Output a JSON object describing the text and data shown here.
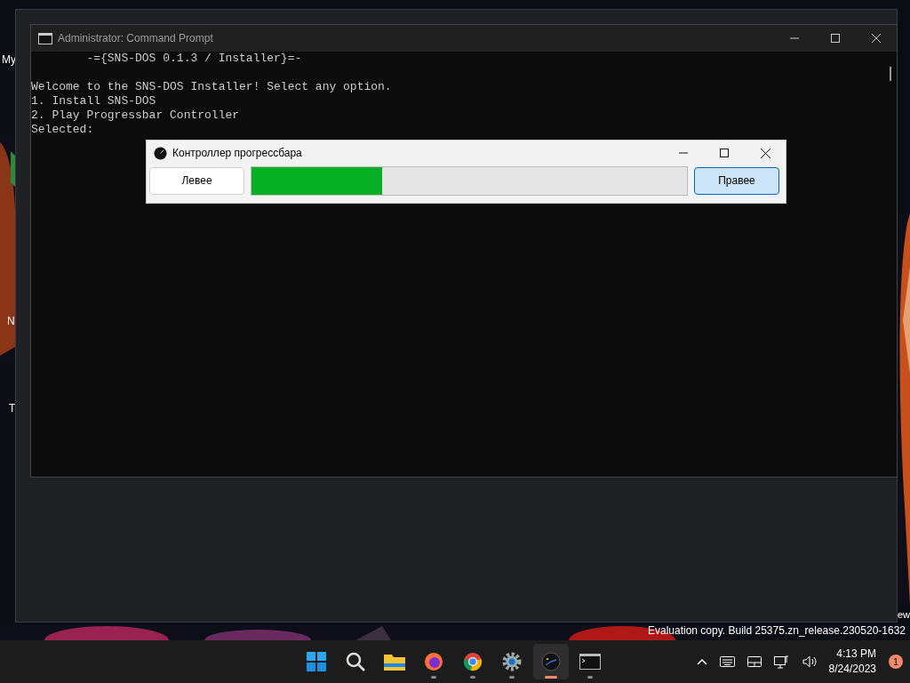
{
  "desktop": {
    "labels": [
      "My",
      "N",
      "T",
      "ew"
    ],
    "watermark": "Evaluation copy. Build 25375.zn_release.230520-1632"
  },
  "console": {
    "title": "Administrator: Command Prompt",
    "banner": "        -={SNS-DOS 0.1.3 / Installer}=-",
    "lines": [
      "Welcome to the SNS-DOS Installer! Select any option.",
      "1. Install SNS-DOS",
      "2. Play Progressbar Controller",
      "Selected:"
    ]
  },
  "dialog": {
    "title": "Контроллер прогрессбара",
    "left_button": "Левее",
    "right_button": {
      "label": "Правее",
      "hovered": true
    },
    "progress": {
      "level": 0.3
    }
  },
  "taskbar": {
    "apps": [
      {
        "kind": "start",
        "running": false,
        "selected": false
      },
      {
        "kind": "search",
        "running": false,
        "selected": false
      },
      {
        "kind": "folder",
        "running": false,
        "selected": false
      },
      {
        "kind": "fox",
        "running": true,
        "selected": false
      },
      {
        "kind": "browser",
        "running": true,
        "selected": false
      },
      {
        "kind": "gear",
        "running": true,
        "selected": false
      },
      {
        "kind": "dial",
        "running": true,
        "selected": true
      },
      {
        "kind": "terminal",
        "running": true,
        "selected": false
      }
    ],
    "time": "4:13 PM",
    "date": "8/24/2023",
    "notifications": "1"
  }
}
